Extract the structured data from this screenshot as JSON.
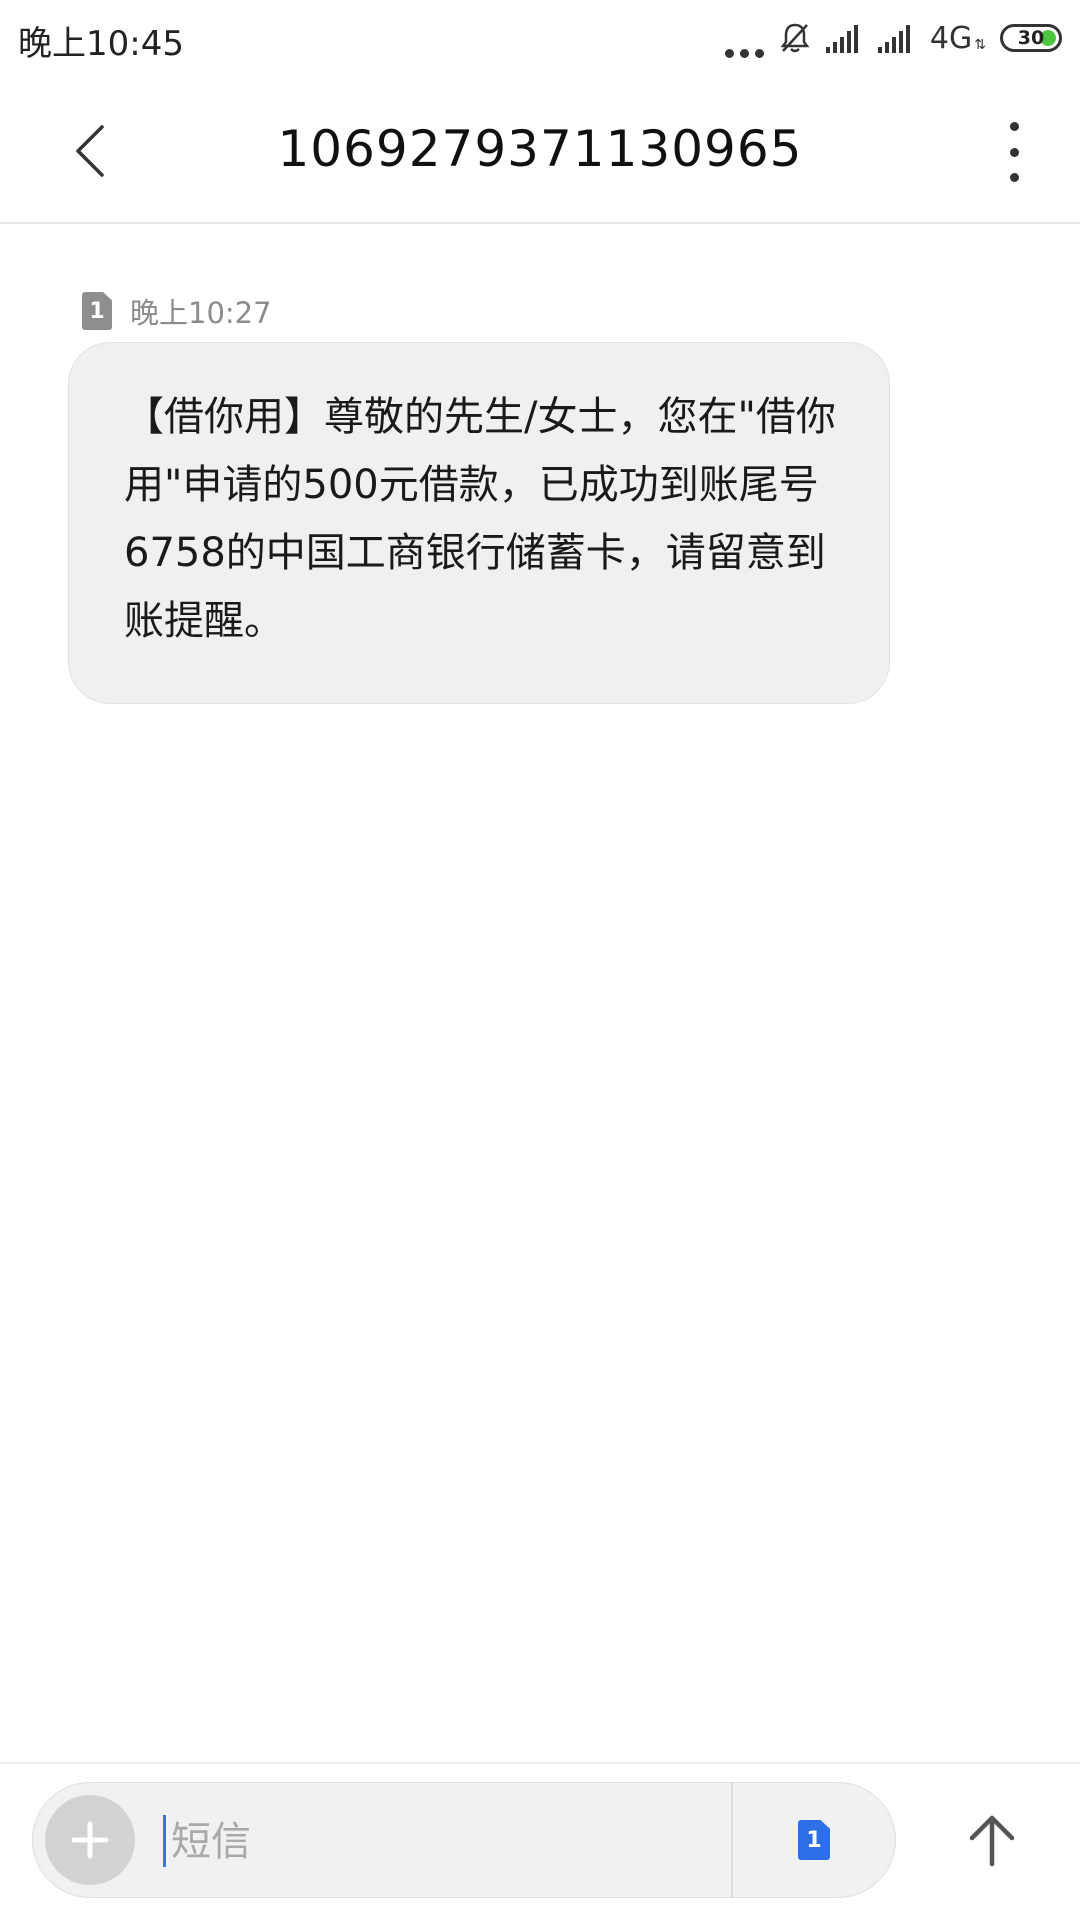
{
  "status_bar": {
    "time": "晚上10:45",
    "network": "4G",
    "battery": "30",
    "icons": [
      "more-dots-icon",
      "bell-muted-icon",
      "signal-icon",
      "signal-icon",
      "data-arrows-icon",
      "battery-icon"
    ]
  },
  "header": {
    "title": "1069279371130965",
    "back_icon": "chevron-left-icon",
    "more_icon": "more-vertical-icon"
  },
  "conversation": {
    "messages": [
      {
        "sim": "1",
        "time": "晚上10:27",
        "text": "【借你用】尊敬的先生/女士，您在\"借你用\"申请的500元借款，已成功到账尾号6758的中国工商银行储蓄卡，请留意到账提醒。"
      }
    ]
  },
  "composer": {
    "placeholder": "短信",
    "value": "",
    "sim": "1",
    "add_icon": "plus-icon",
    "send_icon": "arrow-up-icon"
  },
  "colors": {
    "accent": "#2d6fe6",
    "bubble": "#f0f0f0",
    "battery_fill": "#4cc53f"
  }
}
